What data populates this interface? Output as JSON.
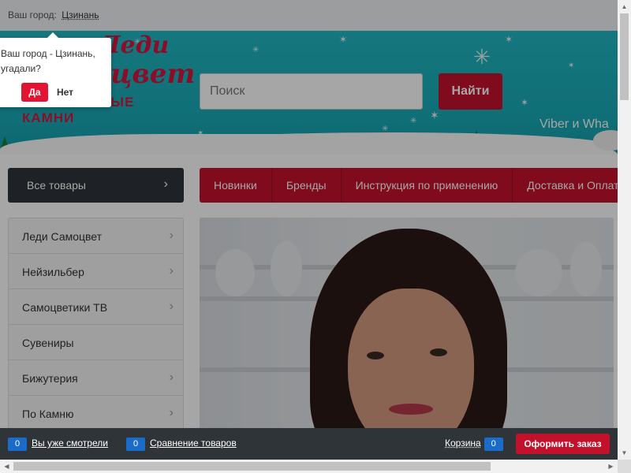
{
  "city_bar": {
    "label": "Ваш город:",
    "city": "Цзинань"
  },
  "logo": {
    "line1": "Леди",
    "line2": "Самоцвет",
    "tagline": "НАТУРАЛЬНЫЕ КАМНИ"
  },
  "search": {
    "placeholder": "Поиск",
    "button": "Найти"
  },
  "contact": {
    "text": "Viber и Wha"
  },
  "nav": {
    "all_goods": "Все товары",
    "menu": [
      "Новинки",
      "Бренды",
      "Инструкция по применению",
      "Доставка и Оплата"
    ]
  },
  "sidebar": {
    "items": [
      "Леди Самоцвет",
      "Нейзильбер",
      "Самоцветики ТВ",
      "Сувениры",
      "Бижутерия",
      "По Камню"
    ]
  },
  "popup": {
    "question_line1": "Ваш город - Цзинань,",
    "question_line2": "угадали?",
    "yes": "Да",
    "no": "Нет"
  },
  "bottom_bar": {
    "viewed_count": "0",
    "viewed_label": "Вы уже смотрели",
    "compare_count": "0",
    "compare_label": "Сравнение товаров",
    "cart_label": "Корзина",
    "cart_count": "0",
    "order_button": "Оформить заказ"
  },
  "colors": {
    "brand_red": "#c4112b",
    "header_teal": "#19aab6",
    "dark": "#2f3439",
    "badge_blue": "#1b6cc9"
  }
}
